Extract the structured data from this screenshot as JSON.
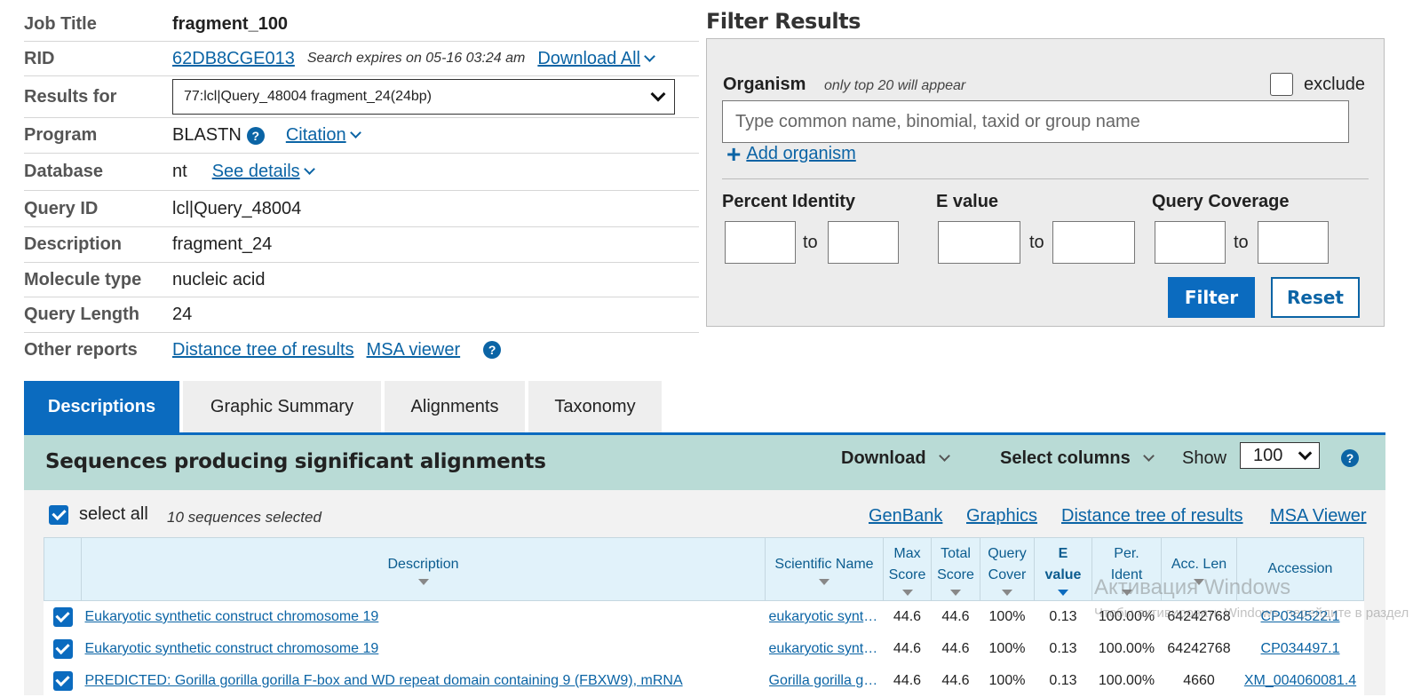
{
  "job": {
    "job_title_label": "Job Title",
    "job_title": "fragment_100",
    "rid_label": "RID",
    "rid": "62DB8CGE013",
    "expires": "Search expires on 05-16 03:24 am",
    "download_all": "Download All",
    "results_for_label": "Results for",
    "results_for": "77:lcl|Query_48004 fragment_24(24bp)",
    "program_label": "Program",
    "program": "BLASTN",
    "citation": "Citation",
    "database_label": "Database",
    "database": "nt",
    "see_details": "See details",
    "query_id_label": "Query ID",
    "query_id": "lcl|Query_48004",
    "description_label": "Description",
    "description": "fragment_24",
    "molecule_label": "Molecule type",
    "molecule": "nucleic acid",
    "length_label": "Query Length",
    "length": "24",
    "other_label": "Other reports",
    "distance_tree": "Distance tree of results",
    "msa_viewer": "MSA viewer",
    "help": "?"
  },
  "filter": {
    "title": "Filter Results",
    "organism_label": "Organism",
    "organism_note": "only top 20 will appear",
    "exclude": "exclude",
    "organism_placeholder": "Type common  name, binomial, taxid or group  name",
    "add_organism": "Add organism",
    "percent_identity": "Percent Identity",
    "e_value": "E value",
    "query_coverage": "Query Coverage",
    "to": "to",
    "filter_btn": "Filter",
    "reset_btn": "Reset"
  },
  "tabs": [
    "Descriptions",
    "Graphic Summary",
    "Alignments",
    "Taxonomy"
  ],
  "results_bar": {
    "title": "Sequences producing significant alignments",
    "download": "Download",
    "select_columns": "Select columns",
    "show": "Show",
    "show_value": "100",
    "help": "?"
  },
  "selection": {
    "select_all": "select all",
    "count": "10 sequences selected",
    "links": [
      "GenBank",
      "Graphics",
      "Distance tree of results",
      "MSA Viewer"
    ]
  },
  "table": {
    "headers": {
      "description": "Description",
      "scientific_name": "Scientific Name",
      "max_score": [
        "Max",
        "Score"
      ],
      "total_score": [
        "Total",
        "Score"
      ],
      "query_cover": [
        "Query",
        "Cover"
      ],
      "e_value": [
        "E",
        "value"
      ],
      "per_ident": [
        "Per.",
        "Ident"
      ],
      "acc_len": "Acc. Len",
      "accession": "Accession"
    },
    "rows": [
      {
        "description": "Eukaryotic synthetic construct chromosome 19",
        "scientific_name": "eukaryotic synthetic construct",
        "max_score": "44.6",
        "total_score": "44.6",
        "query_cover": "100%",
        "e_value": "0.13",
        "per_ident": "100.00%",
        "acc_len": "64242768",
        "accession": "CP034522.1"
      },
      {
        "description": "Eukaryotic synthetic construct chromosome 19",
        "scientific_name": "eukaryotic synthetic construct",
        "max_score": "44.6",
        "total_score": "44.6",
        "query_cover": "100%",
        "e_value": "0.13",
        "per_ident": "100.00%",
        "acc_len": "64242768",
        "accession": "CP034497.1"
      },
      {
        "description": "PREDICTED: Gorilla gorilla gorilla F-box and WD repeat domain containing 9 (FBXW9), mRNA",
        "scientific_name": "Gorilla gorilla gorilla",
        "max_score": "44.6",
        "total_score": "44.6",
        "query_cover": "100%",
        "e_value": "0.13",
        "per_ident": "100.00%",
        "acc_len": "4660",
        "accession": "XM_004060081.4"
      }
    ]
  },
  "watermark": {
    "line1": "Активация Windows",
    "line2": "Чтобы активировать Windows, перейдите в раздел \"Параметры\"."
  }
}
